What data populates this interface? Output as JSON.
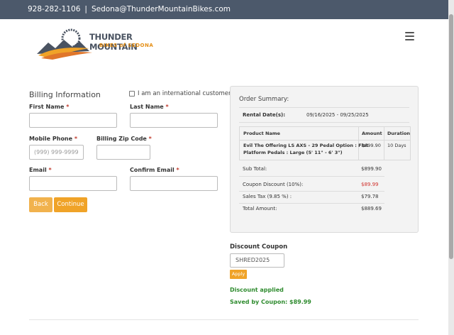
{
  "topbar": {
    "phone": "928-282-1106",
    "separator": "|",
    "email": "Sedona@ThunderMountainBikes.com"
  },
  "logo": {
    "brand": "THUNDER MOUNTAIN",
    "sub": "BIKES of SEDONA"
  },
  "billing": {
    "title": "Billing Information",
    "international_label": "I am an international customer",
    "required_mark": "*",
    "first_name_label": "First Name",
    "last_name_label": "Last Name",
    "mobile_label": "Mobile Phone",
    "mobile_placeholder": "(999) 999-9999",
    "zip_label": "Billing Zip Code",
    "email_label": "Email",
    "confirm_email_label": "Confirm Email",
    "back_label": "Back",
    "continue_label": "Continue"
  },
  "summary": {
    "title": "Order Summary:",
    "rental_dates_label": "Rental Date(s):",
    "rental_dates_value": "09/16/2025 - 09/25/2025",
    "columns": [
      "Product Name",
      "Amount",
      "Duration"
    ],
    "product_line1": "Evil The Offering LS AXS - 29 Pedal Option : Flat",
    "product_line2": "Platform Pedals : Large (5' 11\" - 6' 3\")",
    "product_amount": "$899.90",
    "product_duration": "10 Days",
    "rows": [
      {
        "label": "Sub Total:",
        "value": "$899.90"
      },
      {
        "label": "Coupon Discount (10%):",
        "value": "$89.99"
      },
      {
        "label": "Sales Tax (9.85 %) :",
        "value": "$79.78"
      },
      {
        "label": "Total Amount:",
        "value": "$889.69"
      }
    ],
    "discount_color": "#d0302b"
  },
  "coupon": {
    "title": "Discount Coupon",
    "value": "SHRED2025",
    "apply_label": "Apply",
    "applied_text": "Discount applied",
    "saved_text": "Saved by Coupon: $89.99"
  },
  "colors": {
    "topbar": "#4c596b",
    "accent": "#f0a328",
    "success": "#2e8b2e"
  }
}
